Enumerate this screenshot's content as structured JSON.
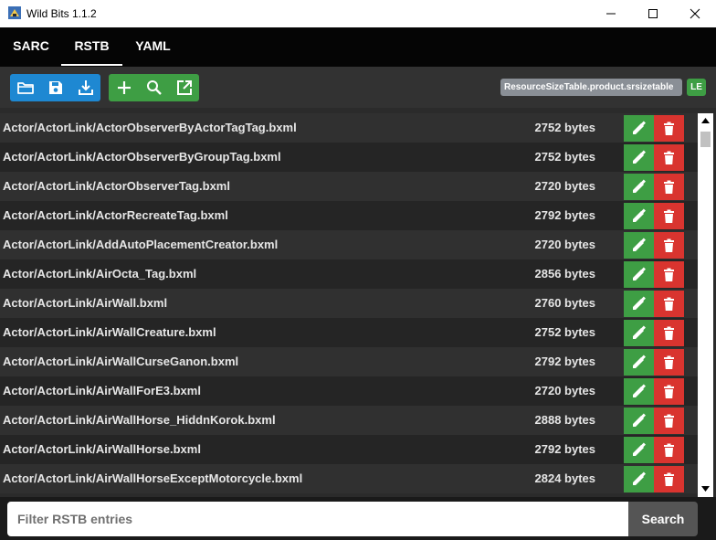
{
  "window": {
    "title": "Wild Bits 1.1.2"
  },
  "tabs": [
    {
      "label": "SARC"
    },
    {
      "label": "RSTB"
    },
    {
      "label": "YAML"
    }
  ],
  "toolbar": {
    "file_label": "ResourceSizeTable.product.srsizetable",
    "endian_badge": "LE"
  },
  "entries": [
    {
      "name": "Actor/ActorLink/ActorObserverByActorTagTag.bxml",
      "size": "2752 bytes"
    },
    {
      "name": "Actor/ActorLink/ActorObserverByGroupTag.bxml",
      "size": "2752 bytes"
    },
    {
      "name": "Actor/ActorLink/ActorObserverTag.bxml",
      "size": "2720 bytes"
    },
    {
      "name": "Actor/ActorLink/ActorRecreateTag.bxml",
      "size": "2792 bytes"
    },
    {
      "name": "Actor/ActorLink/AddAutoPlacementCreator.bxml",
      "size": "2720 bytes"
    },
    {
      "name": "Actor/ActorLink/AirOcta_Tag.bxml",
      "size": "2856 bytes"
    },
    {
      "name": "Actor/ActorLink/AirWall.bxml",
      "size": "2760 bytes"
    },
    {
      "name": "Actor/ActorLink/AirWallCreature.bxml",
      "size": "2752 bytes"
    },
    {
      "name": "Actor/ActorLink/AirWallCurseGanon.bxml",
      "size": "2792 bytes"
    },
    {
      "name": "Actor/ActorLink/AirWallForE3.bxml",
      "size": "2720 bytes"
    },
    {
      "name": "Actor/ActorLink/AirWallHorse_HiddnKorok.bxml",
      "size": "2888 bytes"
    },
    {
      "name": "Actor/ActorLink/AirWallHorse.bxml",
      "size": "2792 bytes"
    },
    {
      "name": "Actor/ActorLink/AirWallHorseExceptMotorcycle.bxml",
      "size": "2824 bytes"
    }
  ],
  "filter": {
    "placeholder": "Filter RSTB entries",
    "value": "",
    "search_label": "Search"
  },
  "colors": {
    "accent_blue": "#1e88d2",
    "accent_green": "#3e9e44",
    "danger_red": "#d9342f"
  }
}
